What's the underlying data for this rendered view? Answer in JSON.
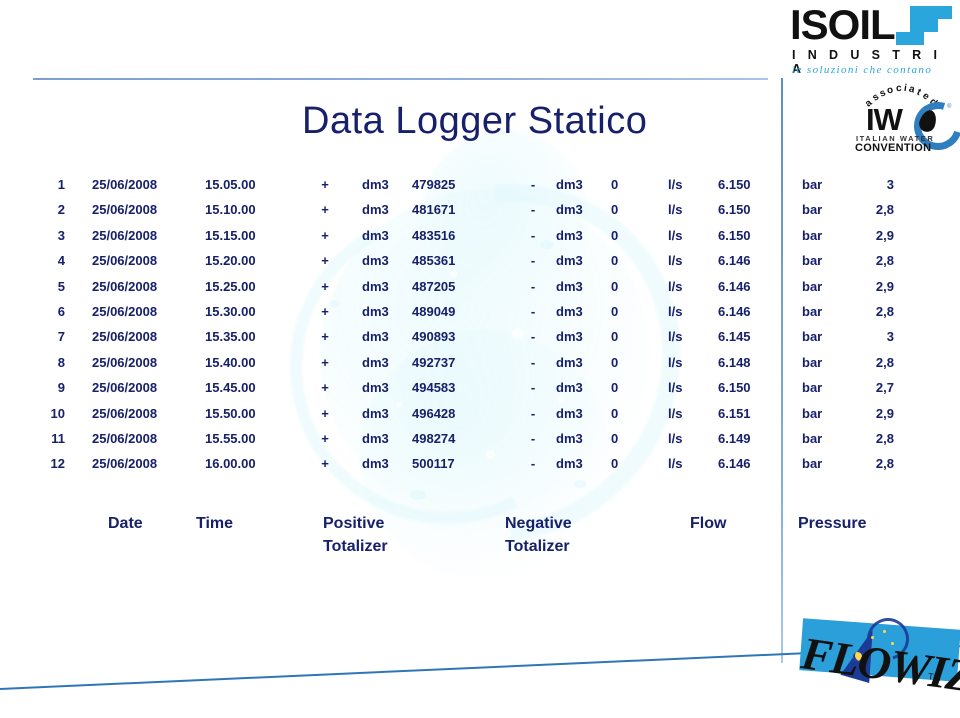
{
  "title": "Data Logger Statico",
  "brand": {
    "isoil_name": "ISOIL",
    "isoil_sub": "I N D U S T R I A",
    "isoil_tagline": "le soluzioni che contano",
    "iwc_assoc": "associated",
    "iwc_mark": "IW",
    "iwc_line1": "ITALIAN WATER",
    "iwc_line2": "CONVENTION",
    "iwc_reg": "®",
    "flowiz_name": "FLOWIZ",
    "flowiz_tm": "TM"
  },
  "colors": {
    "text": "#17206b",
    "rule": "#7d9fd0",
    "accent_blue": "#2a9fda",
    "diagonal": "#2f76b8"
  },
  "labels": {
    "date": "Date",
    "time": "Time",
    "positive_totalizer_line1": "Positive",
    "positive_totalizer_line2": "Totalizer",
    "negative_totalizer_line1": "Negative",
    "negative_totalizer_line2": "Totalizer",
    "flow": "Flow",
    "pressure": "Pressure"
  },
  "table": {
    "columns": [
      "#",
      "Date",
      "Time",
      "PosSign",
      "PosUnit",
      "PosValue",
      "NegSign",
      "NegUnit",
      "NegValue",
      "FlowUnit",
      "FlowValue",
      "PressUnit",
      "PressValue"
    ],
    "rows": [
      {
        "idx": "1",
        "date": "25/06/2008",
        "time": "15.05.00",
        "psign": "+",
        "punit": "dm3",
        "pval": "479825",
        "nsign": "-",
        "nunit": "dm3",
        "nval": "0",
        "funit": "l/s",
        "fval": "6.150",
        "sunit": "bar",
        "sval": "3"
      },
      {
        "idx": "2",
        "date": "25/06/2008",
        "time": "15.10.00",
        "psign": "+",
        "punit": "dm3",
        "pval": "481671",
        "nsign": "-",
        "nunit": "dm3",
        "nval": "0",
        "funit": "l/s",
        "fval": "6.150",
        "sunit": "bar",
        "sval": "2,8"
      },
      {
        "idx": "3",
        "date": "25/06/2008",
        "time": "15.15.00",
        "psign": "+",
        "punit": "dm3",
        "pval": "483516",
        "nsign": "-",
        "nunit": "dm3",
        "nval": "0",
        "funit": "l/s",
        "fval": "6.150",
        "sunit": "bar",
        "sval": "2,9"
      },
      {
        "idx": "4",
        "date": "25/06/2008",
        "time": "15.20.00",
        "psign": "+",
        "punit": "dm3",
        "pval": "485361",
        "nsign": "-",
        "nunit": "dm3",
        "nval": "0",
        "funit": "l/s",
        "fval": "6.146",
        "sunit": "bar",
        "sval": "2,8"
      },
      {
        "idx": "5",
        "date": "25/06/2008",
        "time": "15.25.00",
        "psign": "+",
        "punit": "dm3",
        "pval": "487205",
        "nsign": "-",
        "nunit": "dm3",
        "nval": "0",
        "funit": "l/s",
        "fval": "6.146",
        "sunit": "bar",
        "sval": "2,9"
      },
      {
        "idx": "6",
        "date": "25/06/2008",
        "time": "15.30.00",
        "psign": "+",
        "punit": "dm3",
        "pval": "489049",
        "nsign": "-",
        "nunit": "dm3",
        "nval": "0",
        "funit": "l/s",
        "fval": "6.146",
        "sunit": "bar",
        "sval": "2,8"
      },
      {
        "idx": "7",
        "date": "25/06/2008",
        "time": "15.35.00",
        "psign": "+",
        "punit": "dm3",
        "pval": "490893",
        "nsign": "-",
        "nunit": "dm3",
        "nval": "0",
        "funit": "l/s",
        "fval": "6.145",
        "sunit": "bar",
        "sval": "3"
      },
      {
        "idx": "8",
        "date": "25/06/2008",
        "time": "15.40.00",
        "psign": "+",
        "punit": "dm3",
        "pval": "492737",
        "nsign": "-",
        "nunit": "dm3",
        "nval": "0",
        "funit": "l/s",
        "fval": "6.148",
        "sunit": "bar",
        "sval": "2,8"
      },
      {
        "idx": "9",
        "date": "25/06/2008",
        "time": "15.45.00",
        "psign": "+",
        "punit": "dm3",
        "pval": "494583",
        "nsign": "-",
        "nunit": "dm3",
        "nval": "0",
        "funit": "l/s",
        "fval": "6.150",
        "sunit": "bar",
        "sval": "2,7"
      },
      {
        "idx": "10",
        "date": "25/06/2008",
        "time": "15.50.00",
        "psign": "+",
        "punit": "dm3",
        "pval": "496428",
        "nsign": "-",
        "nunit": "dm3",
        "nval": "0",
        "funit": "l/s",
        "fval": "6.151",
        "sunit": "bar",
        "sval": "2,9"
      },
      {
        "idx": "11",
        "date": "25/06/2008",
        "time": "15.55.00",
        "psign": "+",
        "punit": "dm3",
        "pval": "498274",
        "nsign": "-",
        "nunit": "dm3",
        "nval": "0",
        "funit": "l/s",
        "fval": "6.149",
        "sunit": "bar",
        "sval": "2,8"
      },
      {
        "idx": "12",
        "date": "25/06/2008",
        "time": "16.00.00",
        "psign": "+",
        "punit": "dm3",
        "pval": "500117",
        "nsign": "-",
        "nunit": "dm3",
        "nval": "0",
        "funit": "l/s",
        "fval": "6.146",
        "sunit": "bar",
        "sval": "2,8"
      }
    ]
  }
}
